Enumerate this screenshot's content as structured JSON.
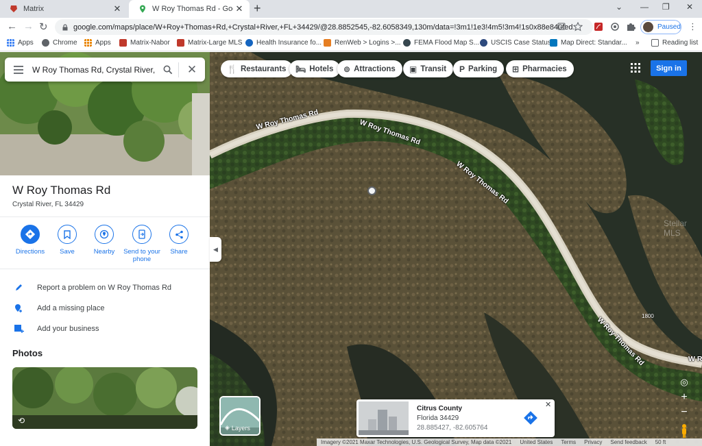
{
  "browser": {
    "tabs": [
      {
        "title": "Matrix",
        "favicon": "matrix-favicon"
      },
      {
        "title": "W Roy Thomas Rd - Google Maps",
        "favicon": "google-maps-favicon"
      }
    ],
    "url": "google.com/maps/place/W+Roy+Thomas+Rd,+Crystal+River,+FL+34429/@28.8852545,-82.6058349,130m/data=!3m1!1e3!4m5!3m4!1s0x88e840fed...",
    "profile_label": "Paused",
    "bookmarks": [
      "Apps",
      "Chrome",
      "Apps",
      "Matrix-Nabor",
      "Matrix-Large MLS",
      "Health Insurance fo...",
      "RenWeb > Logins >...",
      "FEMA Flood Map S...",
      "USCIS Case Status",
      "Map Direct: Standar..."
    ],
    "reading_list": "Reading list",
    "overflow": "»"
  },
  "search": {
    "query": "W Roy Thomas Rd, Crystal River, FL"
  },
  "place": {
    "name": "W Roy Thomas Rd",
    "address": "Crystal River, FL 34429"
  },
  "actions": [
    {
      "label": "Directions",
      "icon": "directions-icon"
    },
    {
      "label": "Save",
      "icon": "bookmark-icon"
    },
    {
      "label": "Nearby",
      "icon": "nearby-icon"
    },
    {
      "label_line1": "Send to your",
      "label_line2": "phone",
      "icon": "send-to-phone-icon"
    },
    {
      "label": "Share",
      "icon": "share-icon"
    }
  ],
  "rows": [
    {
      "label": "Report a problem on W Roy Thomas Rd",
      "icon": "pencil-icon"
    },
    {
      "label": "Add a missing place",
      "icon": "add-place-icon"
    },
    {
      "label": "Add your business",
      "icon": "add-business-icon"
    }
  ],
  "photos_heading": "Photos",
  "map": {
    "chips": [
      {
        "label": "Restaurants",
        "icon": "fork-knife-icon"
      },
      {
        "label": "Hotels",
        "icon": "bed-icon"
      },
      {
        "label": "Attractions",
        "icon": "camera-icon"
      },
      {
        "label": "Transit",
        "icon": "train-icon"
      },
      {
        "label": "Parking",
        "icon": "parking-icon"
      },
      {
        "label": "Pharmacies",
        "icon": "pharmacy-icon"
      }
    ],
    "sign_in": "Sign in",
    "road_labels": [
      "W Roy Thomas Rd",
      "W Roy Thomas Rd",
      "W Roy Thomas Rd",
      "W Roy Thomas Rd",
      "W R"
    ],
    "watermark": "Stellar MLS",
    "elevation_label": "1800",
    "layers_label": "Layers",
    "info_card": {
      "title": "Citrus County",
      "subtitle": "Florida 34429",
      "coords": "28.885427, -82.605764"
    },
    "footer": [
      "Imagery ©2021 Maxar Technologies, U.S. Geological Survey, Map data ©2021",
      "United States",
      "Terms",
      "Privacy",
      "Send feedback",
      "50 ft"
    ]
  },
  "colors": {
    "accent": "#1a73e8",
    "tab_bg": "#dee1e6"
  }
}
